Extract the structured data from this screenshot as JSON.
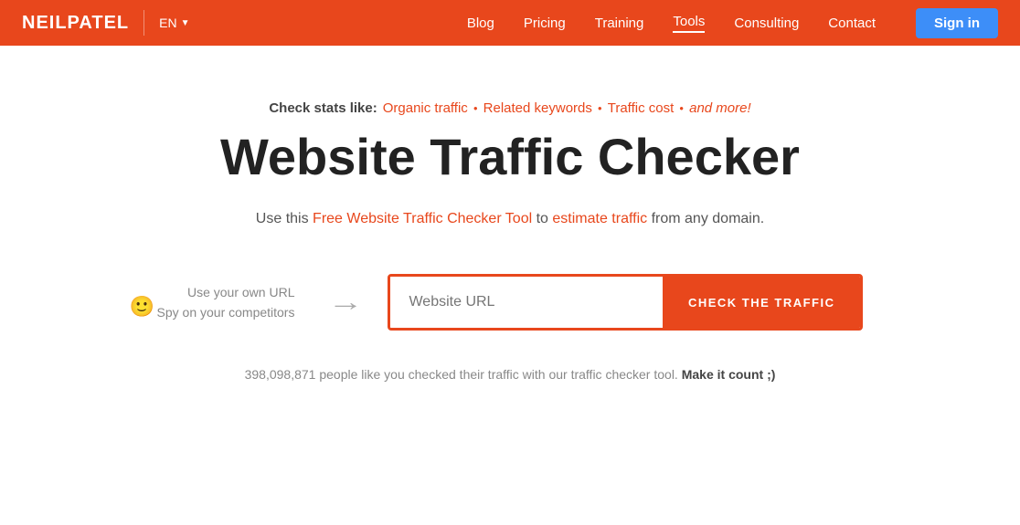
{
  "header": {
    "logo": "NEILPATEL",
    "lang": "EN",
    "nav": [
      {
        "label": "Blog",
        "active": false
      },
      {
        "label": "Pricing",
        "active": false
      },
      {
        "label": "Training",
        "active": false
      },
      {
        "label": "Tools",
        "active": true
      },
      {
        "label": "Consulting",
        "active": false
      },
      {
        "label": "Contact",
        "active": false
      }
    ],
    "signin": "Sign in"
  },
  "main": {
    "stats_label": "Check stats like:",
    "stats_items": [
      "Organic traffic",
      "Related keywords",
      "Traffic cost",
      "and more!"
    ],
    "heading": "Website Traffic Checker",
    "description_parts": {
      "pre": "Use this ",
      "highlight1": "Free Website Traffic Checker Tool",
      "mid": " to ",
      "highlight2": "estimate traffic",
      "post": " from any domain."
    },
    "hint_line1": "Use your own URL",
    "hint_line2": "Spy on your competitors",
    "url_placeholder": "Website URL",
    "check_btn": "CHECK THE TRAFFIC",
    "footer_stat_pre": "398,098,871",
    "footer_stat_text": " people like you checked their traffic with our traffic checker tool. ",
    "footer_stat_bold": "Make it count ;)"
  }
}
